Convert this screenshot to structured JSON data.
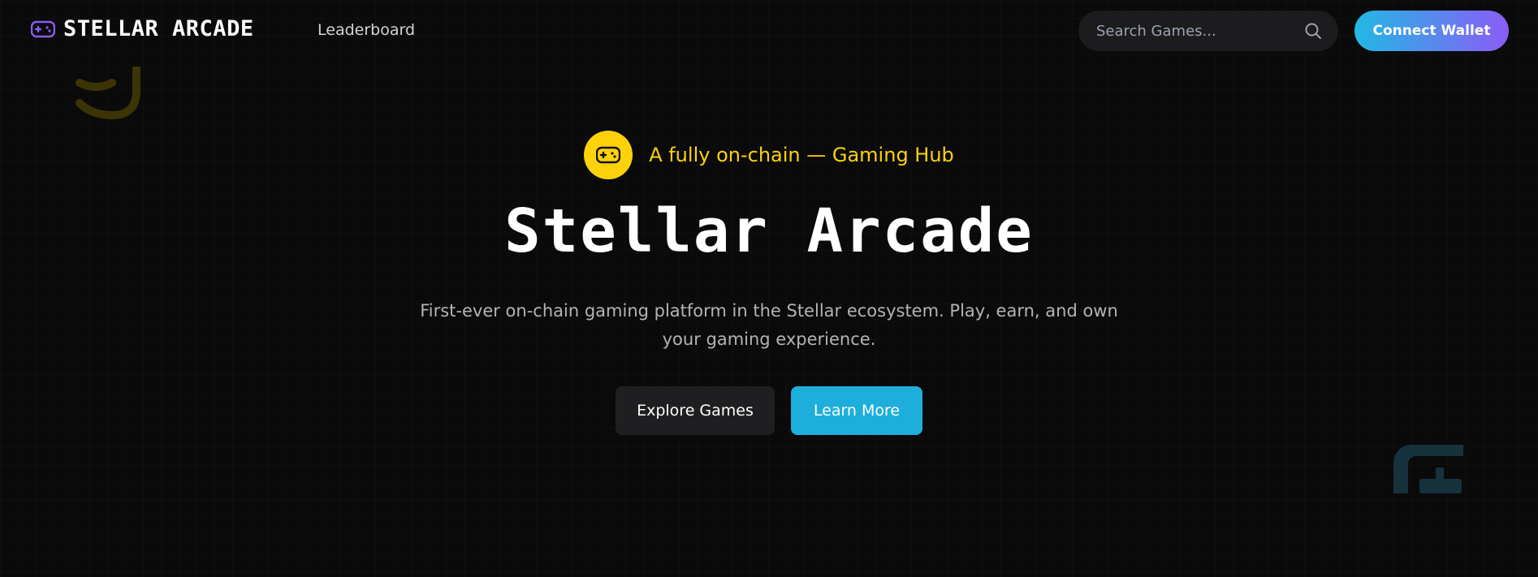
{
  "nav": {
    "brand": "STELLAR ARCADE",
    "brand_icon": "gamepad-icon",
    "links": [
      {
        "label": "Leaderboard"
      }
    ],
    "search": {
      "placeholder": "Search Games...",
      "value": "",
      "icon": "search-icon"
    },
    "connect_wallet": "Connect Wallet"
  },
  "hero": {
    "badge_icon": "gamepad-icon",
    "tagline_prefix": "A fully on-chain — ",
    "tagline_highlight": "Gaming Hub",
    "title": "Stellar Arcade",
    "description": "First-ever on-chain gaming platform in the Stellar ecosystem. Play, earn, and own your gaming experience.",
    "primary_button": "Explore Games",
    "secondary_button": "Learn More"
  },
  "decorations": {
    "top_left": "hook-shape-icon",
    "bottom_right": "controller-shape-icon"
  },
  "colors": {
    "background": "#0a0a0a",
    "accent_yellow": "#fdd20a",
    "accent_blue": "#1eaedb",
    "gradient_start": "#22b8e4",
    "gradient_end": "#8b5cf6",
    "brand_icon": "#8b5cf6"
  }
}
